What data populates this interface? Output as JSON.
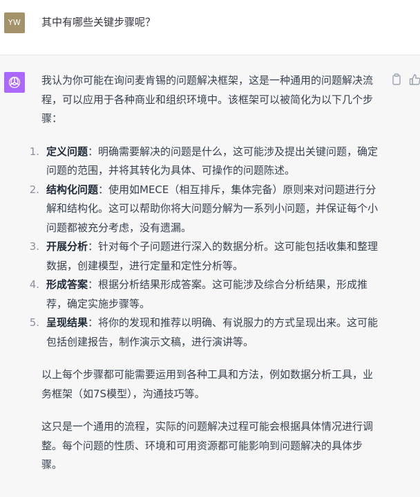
{
  "user": {
    "avatar_initials": "YW",
    "message": "其中有哪些关键步骤呢？"
  },
  "assistant": {
    "avatar_icon": "openai-logo-icon",
    "actions": [
      "copy-icon",
      "thumbs-up-icon"
    ],
    "intro": "我认为你可能在询问麦肯锡的问题解决框架，这是一种通用的问题解决流程，可以应用于各种商业和组织环境中。该框架可以被简化为以下几个步骤：",
    "steps": [
      {
        "num": "1.",
        "title": "定义问题",
        "text": "：明确需要解决的问题是什么，这可能涉及提出关键问题，确定问题的范围，并将其转化为具体、可操作的问题陈述。"
      },
      {
        "num": "2.",
        "title": "结构化问题",
        "text": "：使用如MECE（相互排斥，集体完备）原则来对问题进行分解和结构化。这可以帮助你将大问题分解为一系列小问题，并保证每个小问题都被充分考虑，没有遗漏。"
      },
      {
        "num": "3.",
        "title": "开展分析",
        "text": "：针对每个子问题进行深入的数据分析。这可能包括收集和整理数据，创建模型，进行定量和定性分析等。"
      },
      {
        "num": "4.",
        "title": "形成答案",
        "text": "：根据分析结果形成答案。这可能涉及综合分析结果，形成推荐，确定实施步骤等。"
      },
      {
        "num": "5.",
        "title": "呈现结果",
        "text": "：将你的发现和推荐以明确、有说服力的方式呈现出来。这可能包括创建报告，制作演示文稿，进行演讲等。"
      }
    ],
    "para2": "以上每个步骤都可能需要运用到各种工具和方法，例如数据分析工具，业务框架（如7S模型），沟通技巧等。",
    "para3": "这只是一个通用的流程，实际的问题解决过程可能会根据具体情况进行调整。每个问题的性质、环境和可用资源都可能影响到问题解决的具体步骤。"
  },
  "colors": {
    "user_avatar": "#a3926a",
    "bot_avatar": "#ab68ff",
    "assistant_bg": "#f7f7f8"
  }
}
